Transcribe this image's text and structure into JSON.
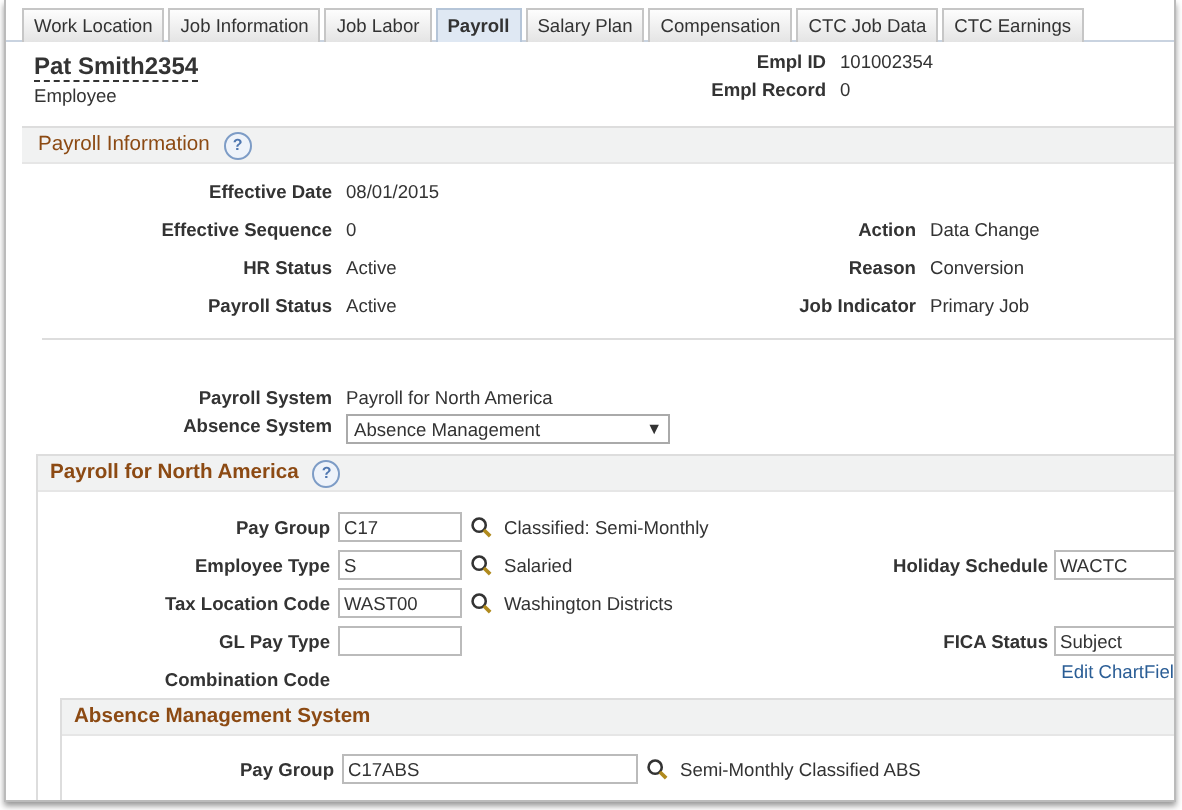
{
  "tabs": [
    {
      "label": "Work Location",
      "selected": false
    },
    {
      "label": "Job Information",
      "selected": false
    },
    {
      "label": "Job Labor",
      "selected": false
    },
    {
      "label": "Payroll",
      "selected": true
    },
    {
      "label": "Salary Plan",
      "selected": false
    },
    {
      "label": "Compensation",
      "selected": false
    },
    {
      "label": "CTC Job Data",
      "selected": false
    },
    {
      "label": "CTC Earnings",
      "selected": false
    }
  ],
  "employee": {
    "name": "Pat Smith2354",
    "role": "Employee",
    "fields": [
      {
        "label": "Empl ID",
        "value": "101002354"
      },
      {
        "label": "Empl Record",
        "value": "0"
      }
    ]
  },
  "payroll_information": {
    "title": "Payroll Information",
    "help": "?",
    "rows": [
      {
        "label": "Effective Date",
        "value": "08/01/2015"
      },
      {
        "label": "Effective Sequence",
        "value": "0",
        "right_label": "Action",
        "right_value": "Data Change"
      },
      {
        "label": "HR Status",
        "value": "Active",
        "right_label": "Reason",
        "right_value": "Conversion"
      },
      {
        "label": "Payroll Status",
        "value": "Active",
        "right_label": "Job Indicator",
        "right_value": "Primary Job"
      }
    ],
    "payroll_system": {
      "label": "Payroll System",
      "value": "Payroll for North America"
    },
    "absence_system": {
      "label": "Absence System",
      "value": "Absence Management",
      "arrow": "▼"
    }
  },
  "payroll_north_america": {
    "title": "Payroll for North America",
    "help": "?",
    "rows": [
      {
        "label": "Pay Group",
        "kind": "lookup",
        "value": "C17",
        "description": "Classified: Semi-Monthly"
      },
      {
        "label": "Employee Type",
        "kind": "lookup",
        "value": "S",
        "description": "Salaried",
        "right_label": "Holiday Schedule",
        "right_value": "WACTC"
      },
      {
        "label": "Tax Location Code",
        "kind": "lookup",
        "value": "WAST00",
        "description": "Washington Districts"
      },
      {
        "label": "GL Pay Type",
        "kind": "input",
        "value": "",
        "right_label": "FICA Status",
        "right_value": "Subject"
      },
      {
        "label": "Combination Code",
        "kind": "label",
        "right_link": "Edit ChartFiel"
      }
    ]
  },
  "absence_management_system": {
    "title": "Absence Management System",
    "rows": [
      {
        "label": "Pay Group",
        "kind": "lookup",
        "value": "C17ABS",
        "description": "Semi-Monthly Classified ABS"
      }
    ]
  }
}
